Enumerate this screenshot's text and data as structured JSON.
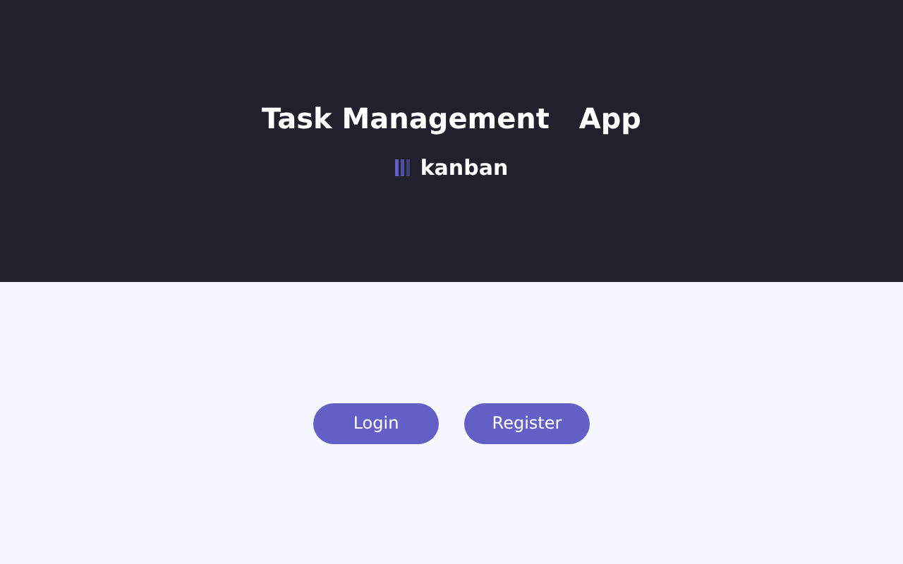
{
  "header": {
    "title": "Task Management   App",
    "logo_text": "kanban"
  },
  "buttons": [
    {
      "label": "Login"
    },
    {
      "label": "Register"
    }
  ]
}
